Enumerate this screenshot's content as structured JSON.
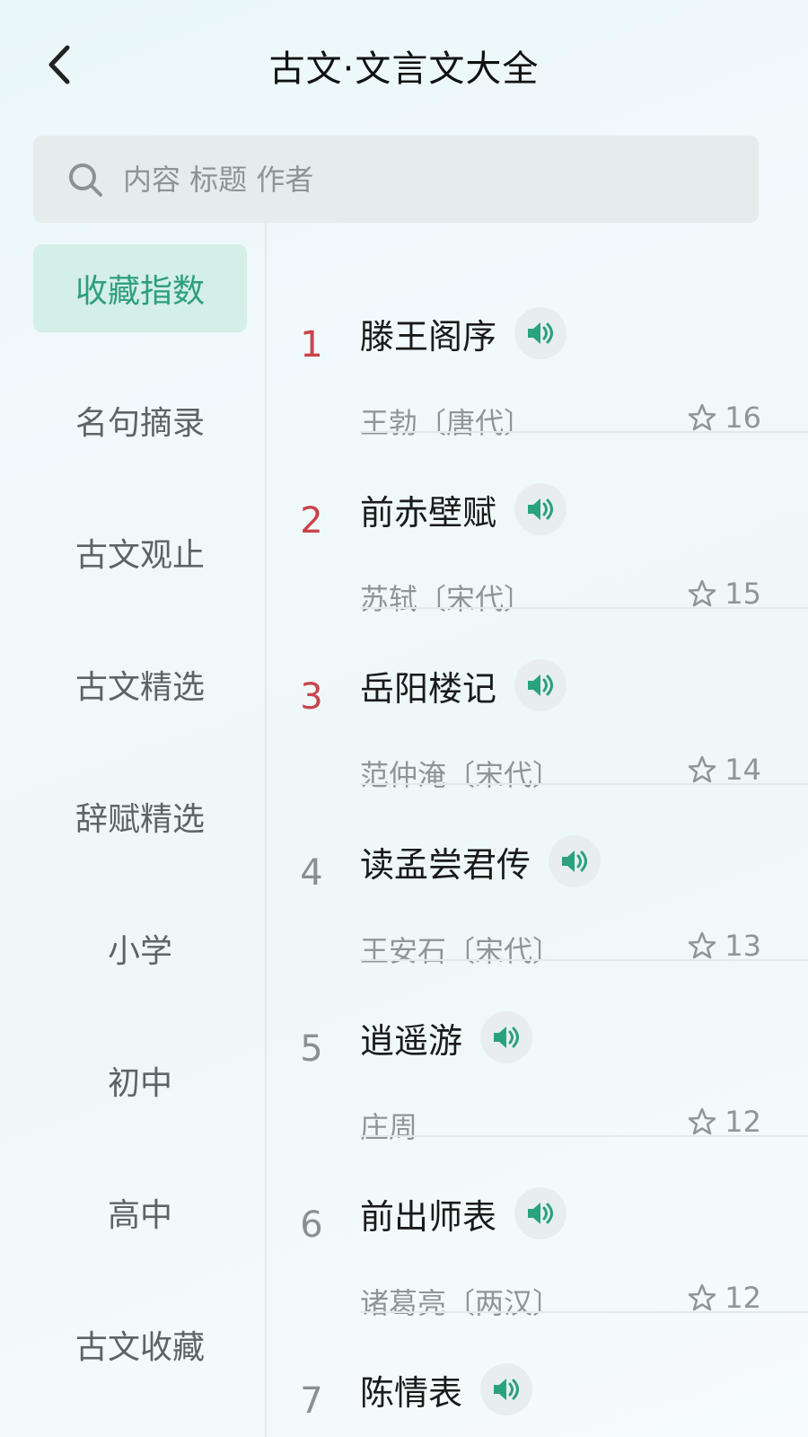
{
  "header": {
    "title": "古文·文言文大全",
    "back_icon": "chevron-left-icon"
  },
  "search": {
    "placeholder": "内容 标题 作者",
    "icon": "search-icon"
  },
  "sidebar": {
    "items": [
      {
        "label": "收藏指数",
        "active": true
      },
      {
        "label": "名句摘录",
        "active": false
      },
      {
        "label": "古文观止",
        "active": false
      },
      {
        "label": "古文精选",
        "active": false
      },
      {
        "label": "辞赋精选",
        "active": false
      },
      {
        "label": "小学",
        "active": false
      },
      {
        "label": "初中",
        "active": false
      },
      {
        "label": "高中",
        "active": false
      },
      {
        "label": "古文收藏",
        "active": false
      }
    ]
  },
  "list": {
    "items": [
      {
        "rank": "1",
        "title": "滕王阁序",
        "author": "王勃〔唐代〕",
        "favorites": "16"
      },
      {
        "rank": "2",
        "title": "前赤壁赋",
        "author": "苏轼〔宋代〕",
        "favorites": "15"
      },
      {
        "rank": "3",
        "title": "岳阳楼记",
        "author": "范仲淹〔宋代〕",
        "favorites": "14"
      },
      {
        "rank": "4",
        "title": "读孟尝君传",
        "author": "王安石〔宋代〕",
        "favorites": "13"
      },
      {
        "rank": "5",
        "title": "逍遥游",
        "author": "庄周",
        "favorites": "12"
      },
      {
        "rank": "6",
        "title": "前出师表",
        "author": "诸葛亮〔两汉〕",
        "favorites": "12"
      },
      {
        "rank": "7",
        "title": "陈情表",
        "author": "",
        "favorites": ""
      }
    ]
  },
  "colors": {
    "accent": "#2e9f7b",
    "active_bg": "#d3efe7",
    "top_rank": "#c9434b"
  }
}
